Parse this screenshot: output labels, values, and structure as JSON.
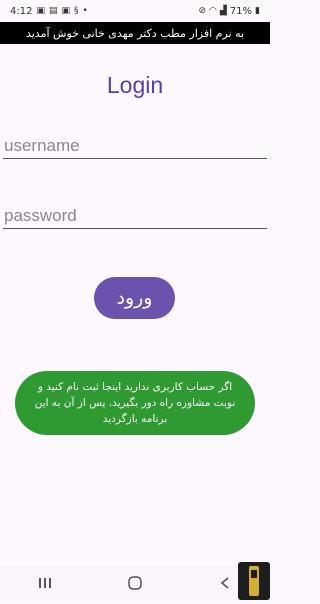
{
  "status": {
    "time": "4:12",
    "battery": "71%"
  },
  "banner": {
    "text": "به نرم افزار مطب دکتر مهدی خانی خوش آمدید"
  },
  "login": {
    "title": "Login",
    "username_placeholder": "username",
    "password_placeholder": "password",
    "submit_label": "ورود"
  },
  "register": {
    "text": "اگر حساب کاربری ندارید اینجا ثبت نام کنید و نوبت مشاوره راه دور بگیرید. پس از آن به این برنامه بازگردید"
  },
  "colors": {
    "title": "#5a3ea6",
    "login_button": "#6b52ad",
    "register_button": "#2f9a31",
    "banner_bg": "#000000",
    "background": "#fdf7fe"
  },
  "nav": {
    "icons": [
      "recent-apps-icon",
      "home-icon",
      "back-icon"
    ]
  }
}
